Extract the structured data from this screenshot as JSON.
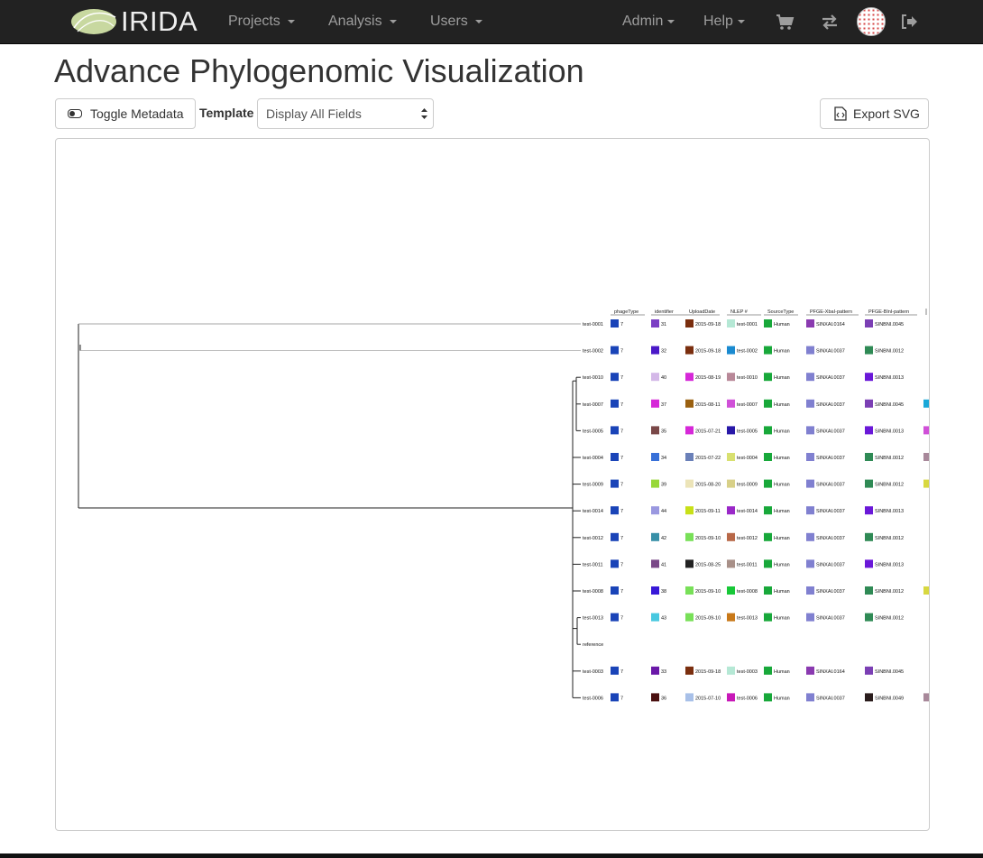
{
  "navbar": {
    "brand": "IRIDA",
    "items": [
      {
        "label": "Projects"
      },
      {
        "label": "Analysis"
      },
      {
        "label": "Users"
      },
      {
        "label": "Admin"
      },
      {
        "label": "Help"
      }
    ],
    "icons": [
      "cart-icon",
      "exchange-icon",
      "avatar",
      "logout-icon"
    ]
  },
  "page": {
    "title": "Advance Phylogenomic Visualization"
  },
  "toolbar": {
    "toggle_label": "Toggle Metadata",
    "template_label": "Template",
    "template_value": "Display All Fields",
    "export_label": "Export SVG"
  },
  "tree": {
    "columns": [
      "phageType",
      "identifier",
      "UploadDate",
      "NLEP #",
      "SourceType",
      "PFGE-XbaI-pattern",
      "PFGE-BlnI-pattern"
    ],
    "leaves": [
      {
        "label": "test-0001",
        "cells": [
          "7",
          "31",
          "2015-09-18",
          "test-0001",
          "Human",
          "SINXAI.0164",
          "SINBNI.0045"
        ],
        "colors": [
          "#1a44b8",
          "#7b3fc4",
          "#7a2e0e",
          "#b5e8d5",
          "#18a83a",
          "#8a3ab0",
          "#7b3fb4"
        ],
        "extra": null
      },
      {
        "label": "test-0002",
        "cells": [
          "7",
          "32",
          "2015-09-18",
          "test-0002",
          "Human",
          "SINXAI.0037",
          "SINBNI.0012"
        ],
        "colors": [
          "#1a44b8",
          "#4a18c8",
          "#7a2e0e",
          "#1a8ad0",
          "#18a83a",
          "#8080d0",
          "#2f8a55"
        ],
        "extra": null
      },
      {
        "label": "test-0010",
        "cells": [
          "7",
          "40",
          "2015-08-19",
          "test-0010",
          "Human",
          "SINXAI.0037",
          "SINBNI.0013"
        ],
        "colors": [
          "#1a44b8",
          "#d4b8e8",
          "#d628d8",
          "#b88898",
          "#18a83a",
          "#8080d0",
          "#6a18d8"
        ],
        "extra": null
      },
      {
        "label": "test-0007",
        "cells": [
          "7",
          "37",
          "2015-08-11",
          "test-0007",
          "Human",
          "SINXAI.0037",
          "SINBNI.0045"
        ],
        "colors": [
          "#1a44b8",
          "#d628d8",
          "#9a6010",
          "#d050d8",
          "#18a83a",
          "#8080d0",
          "#7b3fb4"
        ],
        "extra": "#1aa8d8"
      },
      {
        "label": "test-0005",
        "cells": [
          "7",
          "35",
          "2015-07-21",
          "test-0005",
          "Human",
          "SINXAI.0037",
          "SINBNI.0013"
        ],
        "colors": [
          "#1a44b8",
          "#7a4848",
          "#d628d8",
          "#2818a8",
          "#18a83a",
          "#8080d0",
          "#6a18d8"
        ],
        "extra": "#d050d8"
      },
      {
        "label": "test-0004",
        "cells": [
          "7",
          "34",
          "2015-07-22",
          "test-0004",
          "Human",
          "SINXAI.0037",
          "SINBNI.0012"
        ],
        "colors": [
          "#1a44b8",
          "#3870d8",
          "#6a80b8",
          "#d8e070",
          "#18a83a",
          "#8080d0",
          "#2f8a55"
        ],
        "extra": "#a8889a"
      },
      {
        "label": "test-0009",
        "cells": [
          "7",
          "39",
          "2015-08-20",
          "test-0009",
          "Human",
          "SINXAI.0037",
          "SINBNI.0012"
        ],
        "colors": [
          "#1a44b8",
          "#98d838",
          "#ece4b8",
          "#d8d088",
          "#18a83a",
          "#8080d0",
          "#2f8a55"
        ],
        "extra": "#d8d840"
      },
      {
        "label": "test-0014",
        "cells": [
          "7",
          "44",
          "2015-09-11",
          "test-0014",
          "Human",
          "SINXAI.0037",
          "SINBNI.0013"
        ],
        "colors": [
          "#1a44b8",
          "#9a98e0",
          "#c8e018",
          "#9a28c8",
          "#18a83a",
          "#8080d0",
          "#6a18d8"
        ],
        "extra": null
      },
      {
        "label": "test-0012",
        "cells": [
          "7",
          "42",
          "2015-09-10",
          "test-0012",
          "Human",
          "SINXAI.0037",
          "SINBNI.0012"
        ],
        "colors": [
          "#1a44b8",
          "#3890a8",
          "#78e058",
          "#b86848",
          "#18a83a",
          "#8080d0",
          "#2f8a55"
        ],
        "extra": null
      },
      {
        "label": "test-0011",
        "cells": [
          "7",
          "41",
          "2015-08-25",
          "test-0011",
          "Human",
          "SINXAI.0037",
          "SINBNI.0013"
        ],
        "colors": [
          "#1a44b8",
          "#7a4888",
          "#222222",
          "#a89088",
          "#18a83a",
          "#8080d0",
          "#6a18d8"
        ],
        "extra": null
      },
      {
        "label": "test-0008",
        "cells": [
          "7",
          "38",
          "2015-09-10",
          "test-0008",
          "Human",
          "SINXAI.0037",
          "SINBNI.0012"
        ],
        "colors": [
          "#1a44b8",
          "#3818d8",
          "#78e058",
          "#18c838",
          "#18a83a",
          "#8080d0",
          "#2f8a55"
        ],
        "extra": "#d8d840"
      },
      {
        "label": "test-0013",
        "cells": [
          "7",
          "43",
          "2015-09-10",
          "test-0013",
          "Human",
          "SINXAI.0037",
          "SINBNI.0012"
        ],
        "colors": [
          "#1a44b8",
          "#48c8e0",
          "#78e058",
          "#c87818",
          "#18a83a",
          "#8080d0",
          "#2f8a55"
        ],
        "extra": null
      },
      {
        "label": "reference",
        "cells": null,
        "colors": null,
        "extra": null
      },
      {
        "label": "test-0003",
        "cells": [
          "7",
          "33",
          "2015-09-18",
          "test-0003",
          "Human",
          "SINXAI.0164",
          "SINBNI.0045"
        ],
        "colors": [
          "#1a44b8",
          "#6a18a8",
          "#7a2e0e",
          "#b5e8d5",
          "#18a83a",
          "#8a3ab0",
          "#7b3fb4"
        ],
        "extra": null
      },
      {
        "label": "test-0006",
        "cells": [
          "7",
          "36",
          "2015-07-10",
          "test-0006",
          "Human",
          "SINXAI.0037",
          "SINBNI.0049"
        ],
        "colors": [
          "#1a44b8",
          "#4a1010",
          "#a8c0e8",
          "#c818b8",
          "#18a83a",
          "#8080d0",
          "#2a1c1c"
        ],
        "extra": "#a8889a"
      }
    ]
  }
}
